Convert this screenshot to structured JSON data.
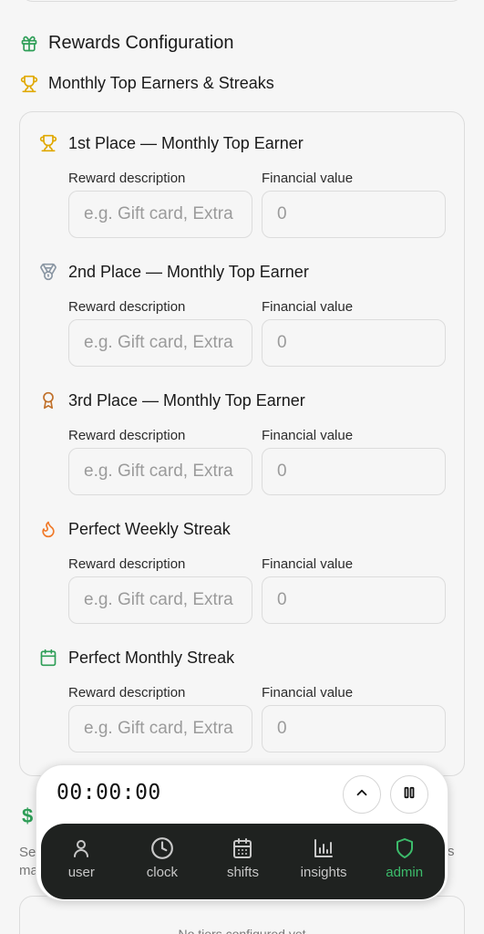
{
  "rewards_section": {
    "title": "Rewards Configuration",
    "icon": "gift-icon",
    "accent": "#2e9e57"
  },
  "monthly_section": {
    "title": "Monthly Top Earners & Streaks",
    "icon": "trophy-icon",
    "accent": "#e0a800"
  },
  "rewards": [
    {
      "title": "1st Place — Monthly Top Earner",
      "icon": "trophy-icon",
      "desc_label": "Reward description",
      "desc_placeholder": "e.g. Gift card, Extra",
      "value_label": "Financial value",
      "value_placeholder": "0"
    },
    {
      "title": "2nd Place — Monthly Top Earner",
      "icon": "medal-icon",
      "desc_label": "Reward description",
      "desc_placeholder": "e.g. Gift card, Extra",
      "value_label": "Financial value",
      "value_placeholder": "0"
    },
    {
      "title": "3rd Place — Monthly Top Earner",
      "icon": "award-ribbon-icon",
      "desc_label": "Reward description",
      "desc_placeholder": "e.g. Gift card, Extra",
      "value_label": "Financial value",
      "value_placeholder": "0"
    },
    {
      "title": "Perfect Weekly Streak",
      "icon": "flame-icon",
      "desc_label": "Reward description",
      "desc_placeholder": "e.g. Gift card, Extra",
      "value_label": "Financial value",
      "value_placeholder": "0"
    },
    {
      "title": "Perfect Monthly Streak",
      "icon": "calendar-icon",
      "desc_label": "Reward description",
      "desc_placeholder": "e.g. Gift card, Extra",
      "value_label": "Financial value",
      "value_placeholder": "0"
    }
  ],
  "tiers_section": {
    "icon": "dollar-icon",
    "text_left_1": "Se",
    "text_left_2": "ma",
    "text_right": "s",
    "empty_text": "No tiers configured yet"
  },
  "timer": {
    "display": "00:00:00",
    "expand_icon": "chevron-up-icon",
    "pause_icon": "pause-icon"
  },
  "nav": {
    "items": [
      {
        "label": "user",
        "icon": "user-icon"
      },
      {
        "label": "clock",
        "icon": "clock-icon"
      },
      {
        "label": "shifts",
        "icon": "calendar-grid-icon"
      },
      {
        "label": "insights",
        "icon": "bar-chart-icon"
      },
      {
        "label": "admin",
        "icon": "shield-icon"
      }
    ],
    "active": "admin",
    "active_color": "#3cbc6b"
  }
}
